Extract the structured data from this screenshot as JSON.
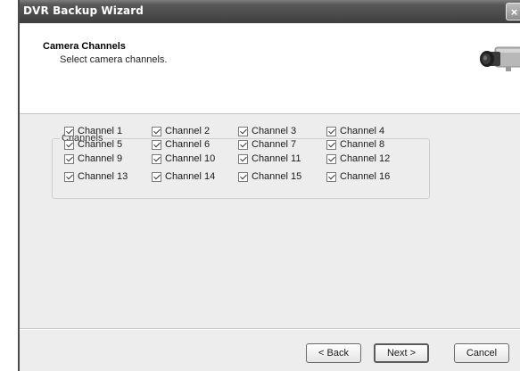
{
  "window": {
    "title": "DVR Backup Wizard",
    "close_glyph": "×"
  },
  "header": {
    "title": "Camera Channels",
    "subtitle": "Select camera channels.",
    "icon": "camera-icon"
  },
  "channels": {
    "group_label": "Channels",
    "items": [
      {
        "label": "Channel 1",
        "checked": true
      },
      {
        "label": "Channel 2",
        "checked": true
      },
      {
        "label": "Channel 3",
        "checked": true
      },
      {
        "label": "Channel 4",
        "checked": true
      },
      {
        "label": "Channel 5",
        "checked": true
      },
      {
        "label": "Channel 6",
        "checked": true
      },
      {
        "label": "Channel 7",
        "checked": true
      },
      {
        "label": "Channel 8",
        "checked": true
      },
      {
        "label": "Channel 9",
        "checked": true
      },
      {
        "label": "Channel 10",
        "checked": true
      },
      {
        "label": "Channel 11",
        "checked": true
      },
      {
        "label": "Channel 12",
        "checked": true
      },
      {
        "label": "Channel 13",
        "checked": true
      },
      {
        "label": "Channel 14",
        "checked": true
      },
      {
        "label": "Channel 15",
        "checked": true
      },
      {
        "label": "Channel 16",
        "checked": true
      }
    ]
  },
  "buttons": {
    "back": "< Back",
    "next": "Next >",
    "cancel": "Cancel"
  },
  "colors": {
    "titlebar": "#4c4c4c",
    "window_bg": "#ededed",
    "header_bg": "#ffffff"
  }
}
